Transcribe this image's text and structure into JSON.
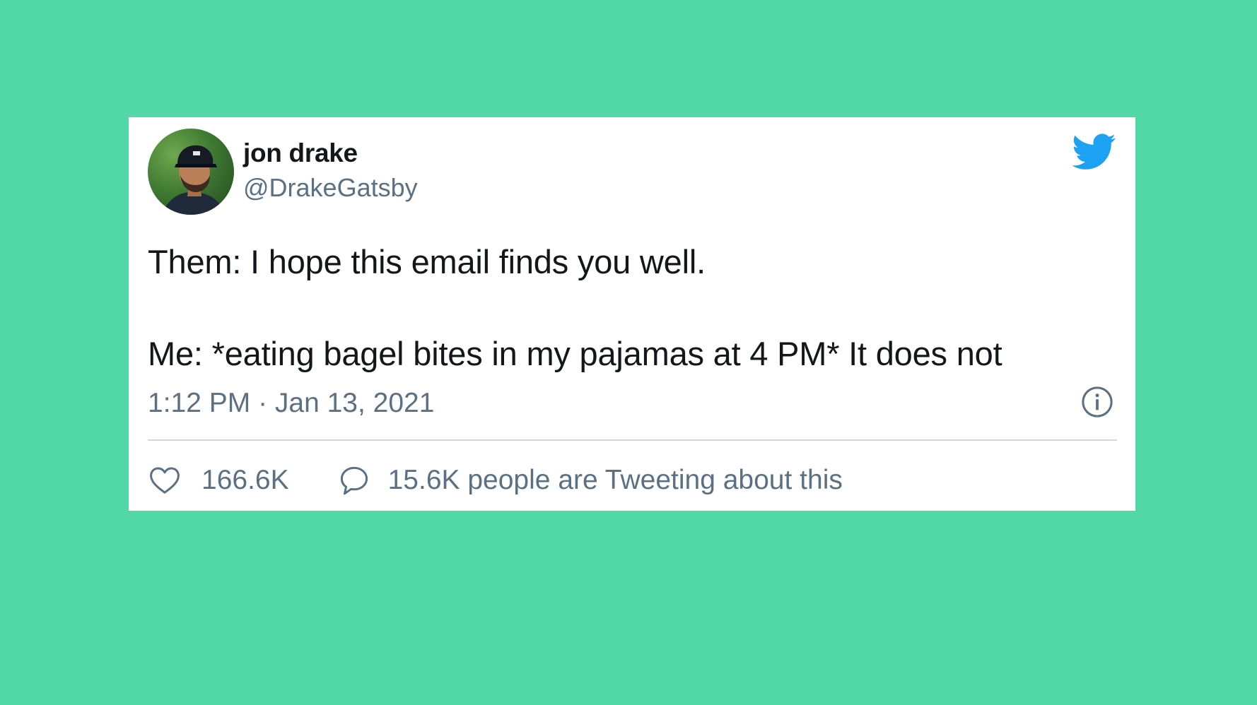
{
  "tweet": {
    "author_name": "jon drake",
    "author_handle": "@DrakeGatsby",
    "text_lines": [
      "Them: I hope this email finds you well.",
      "Me: *eating bagel bites in my pajamas at 4 PM* It does not"
    ],
    "timestamp": "1:12 PM · Jan 13, 2021",
    "like_count": "166.6K",
    "tweeting_about": "15.6K people are Tweeting about this"
  },
  "icons": {
    "brand": "twitter-bird-icon",
    "info": "info-icon",
    "like": "heart-icon",
    "reply": "speech-bubble-icon"
  },
  "colors": {
    "background": "#52d8a7",
    "card": "#ffffff",
    "twitter_blue": "#1da1f2",
    "primary_text": "#14171a",
    "secondary_text": "#5b7083",
    "divider": "#cfd9de"
  }
}
